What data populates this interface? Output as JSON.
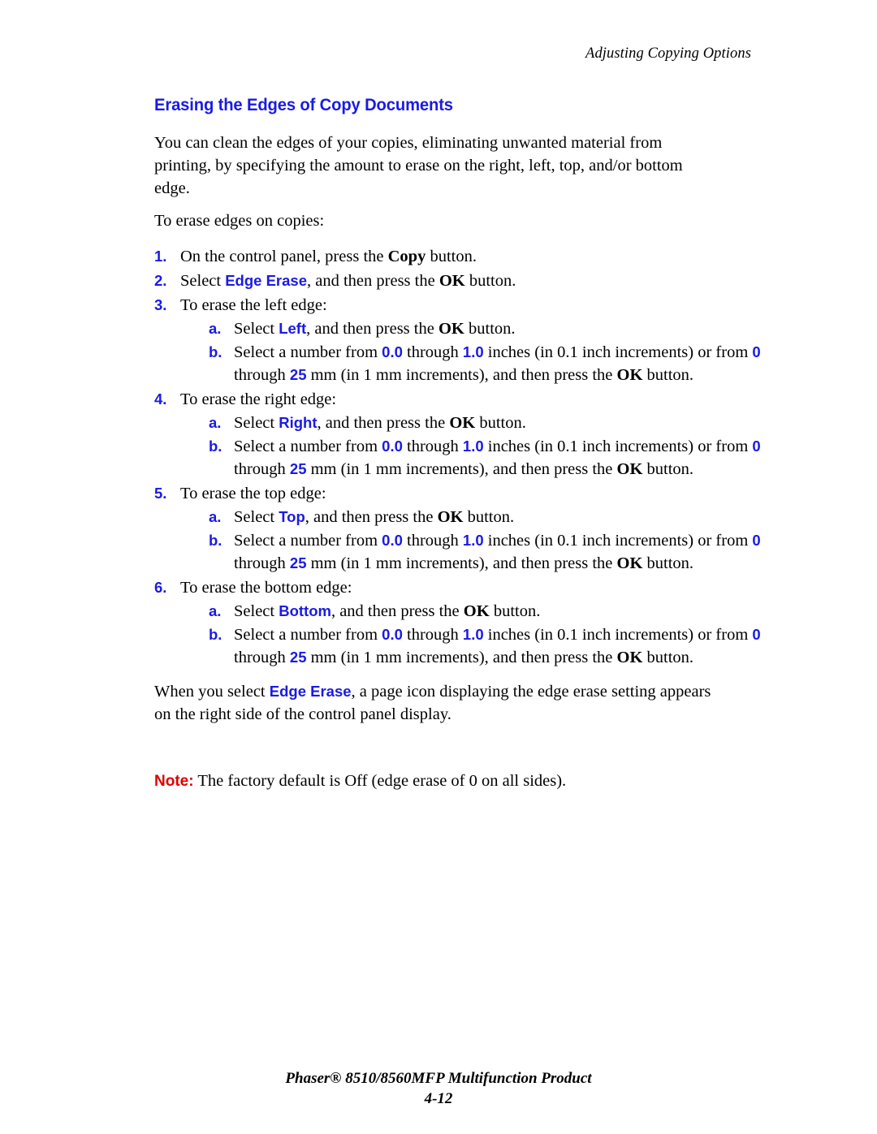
{
  "header": {
    "running_title": "Adjusting Copying Options"
  },
  "section": {
    "title": "Erasing the Edges of Copy Documents",
    "intro": "You can clean the edges of your copies, eliminating unwanted material from printing, by specifying the amount to erase on the right, left, top, and/or bottom edge.",
    "lead_in": "To erase edges on copies:"
  },
  "steps": [
    {
      "marker": "1.",
      "parts": [
        {
          "t": "On the control panel, press the ",
          "style": "plain"
        },
        {
          "t": "Copy",
          "style": "hw-button"
        },
        {
          "t": " button.",
          "style": "plain"
        }
      ]
    },
    {
      "marker": "2.",
      "parts": [
        {
          "t": "Select ",
          "style": "plain"
        },
        {
          "t": "Edge Erase",
          "style": "ui-term"
        },
        {
          "t": ", and then press the ",
          "style": "plain"
        },
        {
          "t": "OK",
          "style": "hw-button"
        },
        {
          "t": " button.",
          "style": "plain"
        }
      ]
    },
    {
      "marker": "3.",
      "parts": [
        {
          "t": "To erase the left edge:",
          "style": "plain"
        }
      ],
      "substeps": [
        {
          "marker": "a.",
          "parts": [
            {
              "t": "Select ",
              "style": "plain"
            },
            {
              "t": "Left",
              "style": "ui-term"
            },
            {
              "t": ", and then press the ",
              "style": "plain"
            },
            {
              "t": "OK",
              "style": "hw-button"
            },
            {
              "t": " button.",
              "style": "plain"
            }
          ]
        },
        {
          "marker": "b.",
          "parts": [
            {
              "t": "Select a number from ",
              "style": "plain"
            },
            {
              "t": "0.0",
              "style": "num-term"
            },
            {
              "t": " through ",
              "style": "plain"
            },
            {
              "t": "1.0",
              "style": "num-term"
            },
            {
              "t": " inches (in 0.1 inch increments) or from ",
              "style": "plain"
            },
            {
              "t": "0",
              "style": "num-term"
            },
            {
              "t": " through ",
              "style": "plain"
            },
            {
              "t": "25",
              "style": "num-term"
            },
            {
              "t": " mm (in 1 mm increments), and then press the ",
              "style": "plain"
            },
            {
              "t": "OK",
              "style": "hw-button"
            },
            {
              "t": " button.",
              "style": "plain"
            }
          ]
        }
      ]
    },
    {
      "marker": "4.",
      "parts": [
        {
          "t": "To erase the right edge:",
          "style": "plain"
        }
      ],
      "substeps": [
        {
          "marker": "a.",
          "parts": [
            {
              "t": "Select ",
              "style": "plain"
            },
            {
              "t": "Right",
              "style": "ui-term"
            },
            {
              "t": ", and then press the ",
              "style": "plain"
            },
            {
              "t": "OK",
              "style": "hw-button"
            },
            {
              "t": " button.",
              "style": "plain"
            }
          ]
        },
        {
          "marker": "b.",
          "parts": [
            {
              "t": "Select a number from ",
              "style": "plain"
            },
            {
              "t": "0.0",
              "style": "num-term"
            },
            {
              "t": " through ",
              "style": "plain"
            },
            {
              "t": "1.0",
              "style": "num-term"
            },
            {
              "t": " inches (in 0.1 inch increments) or from ",
              "style": "plain"
            },
            {
              "t": "0",
              "style": "num-term"
            },
            {
              "t": " through ",
              "style": "plain"
            },
            {
              "t": "25",
              "style": "num-term"
            },
            {
              "t": " mm (in 1 mm increments), and then press the ",
              "style": "plain"
            },
            {
              "t": "OK",
              "style": "hw-button"
            },
            {
              "t": " button.",
              "style": "plain"
            }
          ]
        }
      ]
    },
    {
      "marker": "5.",
      "parts": [
        {
          "t": "To erase the top edge:",
          "style": "plain"
        }
      ],
      "substeps": [
        {
          "marker": "a.",
          "parts": [
            {
              "t": "Select ",
              "style": "plain"
            },
            {
              "t": "Top",
              "style": "ui-term"
            },
            {
              "t": ", and then press the ",
              "style": "plain"
            },
            {
              "t": "OK",
              "style": "hw-button"
            },
            {
              "t": " button.",
              "style": "plain"
            }
          ]
        },
        {
          "marker": "b.",
          "parts": [
            {
              "t": "Select a number from ",
              "style": "plain"
            },
            {
              "t": "0.0",
              "style": "num-term"
            },
            {
              "t": " through ",
              "style": "plain"
            },
            {
              "t": "1.0",
              "style": "num-term"
            },
            {
              "t": " inches (in 0.1 inch increments) or from ",
              "style": "plain"
            },
            {
              "t": "0",
              "style": "num-term"
            },
            {
              "t": " through ",
              "style": "plain"
            },
            {
              "t": "25",
              "style": "num-term"
            },
            {
              "t": " mm (in 1 mm increments), and then press the ",
              "style": "plain"
            },
            {
              "t": "OK",
              "style": "hw-button"
            },
            {
              "t": " button.",
              "style": "plain"
            }
          ]
        }
      ]
    },
    {
      "marker": "6.",
      "parts": [
        {
          "t": "To erase the bottom edge:",
          "style": "plain"
        }
      ],
      "substeps": [
        {
          "marker": "a.",
          "parts": [
            {
              "t": "Select ",
              "style": "plain"
            },
            {
              "t": "Bottom",
              "style": "ui-term"
            },
            {
              "t": ", and then press the ",
              "style": "plain"
            },
            {
              "t": "OK",
              "style": "hw-button"
            },
            {
              "t": " button.",
              "style": "plain"
            }
          ]
        },
        {
          "marker": "b.",
          "parts": [
            {
              "t": "Select a number from ",
              "style": "plain"
            },
            {
              "t": "0.0",
              "style": "num-term"
            },
            {
              "t": " through ",
              "style": "plain"
            },
            {
              "t": "1.0",
              "style": "num-term"
            },
            {
              "t": " inches (in 0.1 inch increments) or from ",
              "style": "plain"
            },
            {
              "t": "0",
              "style": "num-term"
            },
            {
              "t": " through ",
              "style": "plain"
            },
            {
              "t": "25",
              "style": "num-term"
            },
            {
              "t": " mm (in 1 mm increments), and then press the ",
              "style": "plain"
            },
            {
              "t": "OK",
              "style": "hw-button"
            },
            {
              "t": " button.",
              "style": "plain"
            }
          ]
        }
      ]
    }
  ],
  "closing": {
    "parts": [
      {
        "t": "When you select ",
        "style": "plain"
      },
      {
        "t": "Edge Erase",
        "style": "ui-term"
      },
      {
        "t": ", a page icon displaying the edge erase setting appears on the right side of the control panel display.",
        "style": "plain"
      }
    ]
  },
  "note": {
    "label": "Note:",
    "text": " The factory default is Off (edge erase of 0 on all sides)."
  },
  "footer": {
    "product": "Phaser® 8510/8560MFP Multifunction Product",
    "page_number": "4-12"
  },
  "colors": {
    "ui_blue": "#1a1ae6",
    "note_red": "#e00000",
    "body_black": "#000000",
    "page_background": "#ffffff"
  }
}
